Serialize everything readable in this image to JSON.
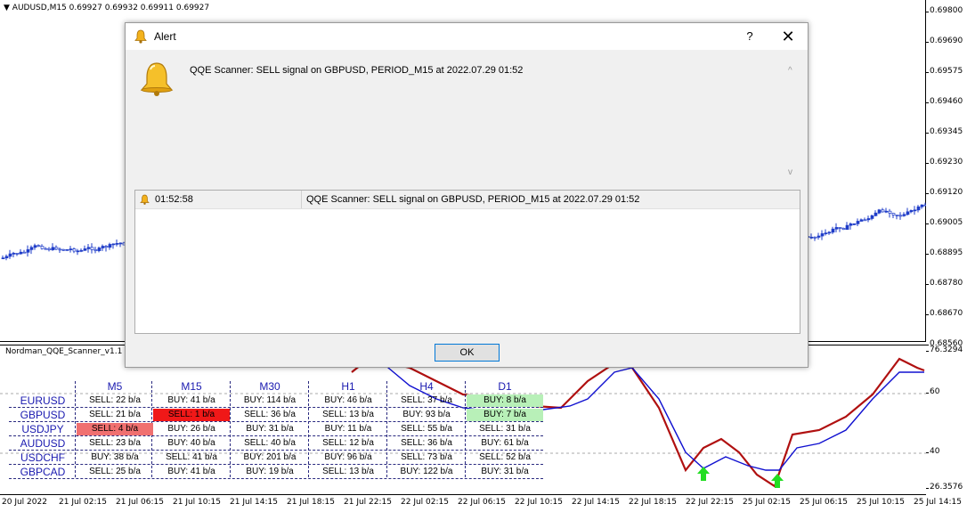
{
  "chart": {
    "header_arrow": "▼",
    "header": "AUDUSD,M15  0.69927 0.69932 0.69911 0.69927",
    "price_labels": [
      "0.69800",
      "0.69690",
      "0.69575",
      "0.69460",
      "0.69345",
      "0.69230",
      "0.69120",
      "0.69005",
      "0.68895",
      "0.68780",
      "0.68670",
      "0.68560"
    ],
    "candle_up_color": "#1f3cc8",
    "candle_down_color": "#1f3cc8"
  },
  "indicator": {
    "name": "Nordman_QQE_Scanner_v1.1",
    "level_labels": [
      "76.3294",
      "60",
      "40",
      "26.3576"
    ],
    "fast_line_color": "#b01010",
    "slow_line_color": "#1010d0",
    "arrow_color": "#22dd22"
  },
  "time_labels": [
    "20 Jul 2022",
    "21 Jul 02:15",
    "21 Jul 06:15",
    "21 Jul 10:15",
    "21 Jul 14:15",
    "21 Jul 18:15",
    "21 Jul 22:15",
    "22 Jul 02:15",
    "22 Jul 06:15",
    "22 Jul 10:15",
    "22 Jul 14:15",
    "22 Jul 18:15",
    "22 Jul 22:15",
    "25 Jul 02:15",
    "25 Jul 06:15",
    "25 Jul 10:15",
    "25 Jul 14:15"
  ],
  "scanner": {
    "timeframes": [
      "M5",
      "M15",
      "M30",
      "H1",
      "H4",
      "D1"
    ],
    "rows": [
      {
        "symbol": "EURUSD",
        "cells": [
          "SELL: 22 b/a",
          "BUY: 41 b/a",
          "BUY: 114 b/a",
          "BUY: 46 b/a",
          "SELL: 37 b/a",
          "BUY: 8 b/a"
        ]
      },
      {
        "symbol": "GBPUSD",
        "cells": [
          "SELL: 21 b/a",
          "SELL: 1 b/a",
          "SELL: 36 b/a",
          "SELL: 13 b/a",
          "BUY: 93 b/a",
          "BUY: 7 b/a"
        ]
      },
      {
        "symbol": "USDJPY",
        "cells": [
          "SELL: 4 b/a",
          "BUY: 26 b/a",
          "BUY: 31 b/a",
          "BUY: 11 b/a",
          "SELL: 55 b/a",
          "SELL: 31 b/a"
        ]
      },
      {
        "symbol": "AUDUSD",
        "cells": [
          "SELL: 23 b/a",
          "BUY: 40 b/a",
          "SELL: 40 b/a",
          "SELL: 12 b/a",
          "SELL: 36 b/a",
          "BUY: 61 b/a"
        ]
      },
      {
        "symbol": "USDCHF",
        "cells": [
          "BUY: 38 b/a",
          "SELL: 41 b/a",
          "BUY: 201 b/a",
          "BUY: 96 b/a",
          "SELL: 73 b/a",
          "SELL: 52 b/a"
        ]
      },
      {
        "symbol": "GBPCAD",
        "cells": [
          "SELL: 25 b/a",
          "BUY: 41 b/a",
          "BUY: 19 b/a",
          "SELL: 13 b/a",
          "BUY: 122 b/a",
          "BUY: 31 b/a"
        ]
      }
    ],
    "highlights": [
      {
        "row": 0,
        "col": 5,
        "color": "#b8f0b8"
      },
      {
        "row": 1,
        "col": 1,
        "color": "#f01818"
      },
      {
        "row": 1,
        "col": 5,
        "color": "#b8f0b8"
      },
      {
        "row": 2,
        "col": 0,
        "color": "#f07070"
      }
    ]
  },
  "dialog": {
    "title": "Alert",
    "help_label": "?",
    "close_label": "✕",
    "message": "QQE Scanner: SELL signal on GBPUSD, PERIOD_M15 at 2022.07.29 01:52",
    "list": {
      "time": "01:52:58",
      "message": "QQE Scanner: SELL signal on GBPUSD, PERIOD_M15 at 2022.07.29 01:52"
    },
    "ok_label": "OK",
    "scroll_up": "^",
    "scroll_down": "v"
  }
}
